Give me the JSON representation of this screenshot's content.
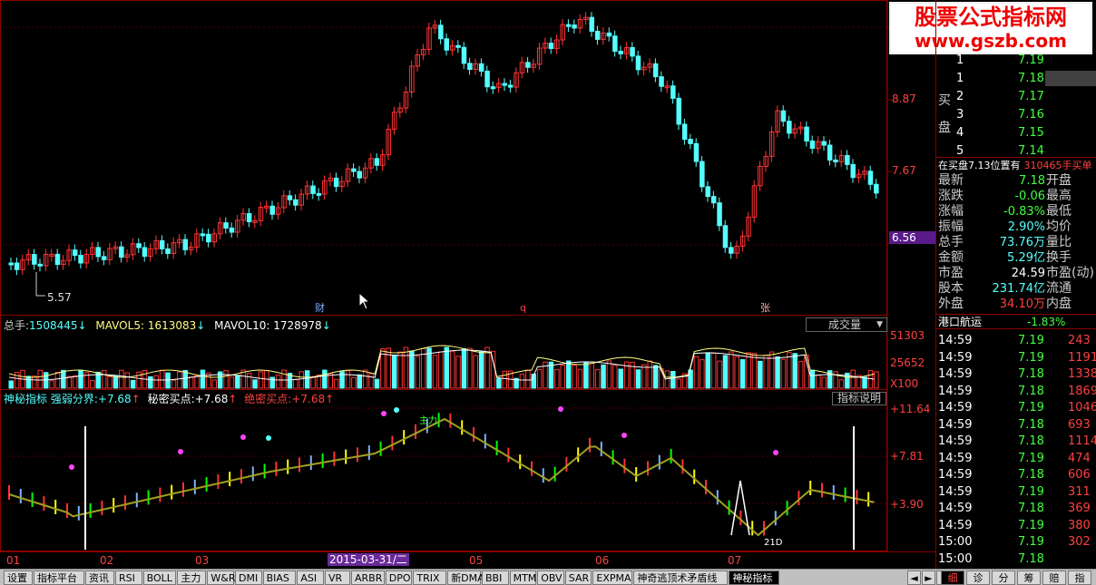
{
  "colors": {
    "up": "#ff3333",
    "down": "#54ffff",
    "green": "#00ff00",
    "yellow": "#ffff00",
    "white": "#ffffff",
    "magenta": "#ff44ff",
    "line": "#a0a020"
  },
  "watermark": {
    "line1": "股票公式指标网",
    "line2": "www.gszb.com"
  },
  "main": {
    "price_labels": [
      "8.87",
      "7.67",
      "6.56"
    ],
    "low_label": "5.57",
    "markers": [
      "财",
      "q",
      "张"
    ]
  },
  "volume": {
    "label_total": "总手:",
    "total": "1508445",
    "label_ma5": "MAVOL5:",
    "ma5": "1613083",
    "label_ma10": "MAVOL10:",
    "ma10": "1728978",
    "dropdown": "成交量",
    "axis": [
      "51303",
      "25652",
      "X100"
    ]
  },
  "indicator": {
    "name": "神秘指标",
    "s1_label": "强弱分界:",
    "s1": "+7.68",
    "s2_label": "秘密买点:",
    "s2": "+7.68",
    "s3_label": "绝密买点:",
    "s3": "+7.68",
    "button": "指标说明",
    "axis": [
      "+11.64",
      "+7.81",
      "+3.90"
    ],
    "zhu_label": "主力",
    "low_tag": "21D"
  },
  "time_axis": {
    "labels": [
      "01",
      "02",
      "03",
      "05",
      "06",
      "07"
    ],
    "highlight": "2015-03-31/二"
  },
  "panel": {
    "buy_label_1": "买",
    "buy_label_2": "盘",
    "buy_rows": [
      {
        "n": "1",
        "p": "7.19"
      },
      {
        "n": "1",
        "p": "7.18"
      },
      {
        "n": "2",
        "p": "7.17"
      },
      {
        "n": "3",
        "p": "7.16"
      },
      {
        "n": "4",
        "p": "7.15"
      },
      {
        "n": "5",
        "p": "7.14"
      }
    ],
    "status": "在买盘7.13位置有",
    "status_vol": "310465手买单",
    "quote": [
      {
        "l": "最新",
        "v": "7.18",
        "r": "开盘"
      },
      {
        "l": "涨跌",
        "v": "-0.06",
        "r": "最高"
      },
      {
        "l": "涨幅",
        "v": "-0.83%",
        "r": "最低"
      },
      {
        "l": "振幅",
        "v": "2.90%",
        "r": "均价"
      },
      {
        "l": "总手",
        "v": "73.76万",
        "r": "量比"
      },
      {
        "l": "金额",
        "v": "5.29亿",
        "r": "换手"
      },
      {
        "l": "市盈",
        "v": "24.59",
        "r": "市盈(动)"
      },
      {
        "l": "股本",
        "v": "231.74亿",
        "r": "流通"
      },
      {
        "l": "外盘",
        "v": "34.10万",
        "r": "内盘"
      }
    ],
    "stock_name": "港口航运",
    "stock_chg": "-1.83%",
    "ticks": [
      {
        "t": "14:59",
        "p": "7.19",
        "v": "243"
      },
      {
        "t": "14:59",
        "p": "7.19",
        "v": "1191"
      },
      {
        "t": "14:59",
        "p": "7.18",
        "v": "1338"
      },
      {
        "t": "14:59",
        "p": "7.18",
        "v": "1869"
      },
      {
        "t": "14:59",
        "p": "7.19",
        "v": "1046"
      },
      {
        "t": "14:59",
        "p": "7.18",
        "v": "693"
      },
      {
        "t": "14:59",
        "p": "7.18",
        "v": "1114"
      },
      {
        "t": "14:59",
        "p": "7.19",
        "v": "474"
      },
      {
        "t": "14:59",
        "p": "7.18",
        "v": "606"
      },
      {
        "t": "14:59",
        "p": "7.19",
        "v": "311"
      },
      {
        "t": "14:59",
        "p": "7.18",
        "v": "369"
      },
      {
        "t": "14:59",
        "p": "7.19",
        "v": "380"
      },
      {
        "t": "15:00",
        "p": "7.19",
        "v": "302"
      },
      {
        "t": "15:00",
        "p": "7.18",
        "v": ""
      }
    ]
  },
  "tabs": [
    "设置",
    "指标平台",
    "资讯",
    "RSI",
    "BOLL",
    "主力",
    "W&R",
    "DMI",
    "BIAS",
    "ASI",
    "VR",
    "ARBR",
    "DPO",
    "TRIX",
    "新DMA",
    "BBI",
    "MTM",
    "OBV",
    "SAR",
    "EXPMA",
    "神奇逃顶术矛盾线",
    "神秘指标"
  ],
  "right_tabs": [
    "细",
    "诊",
    "分",
    "筹",
    "赔",
    "指"
  ]
}
